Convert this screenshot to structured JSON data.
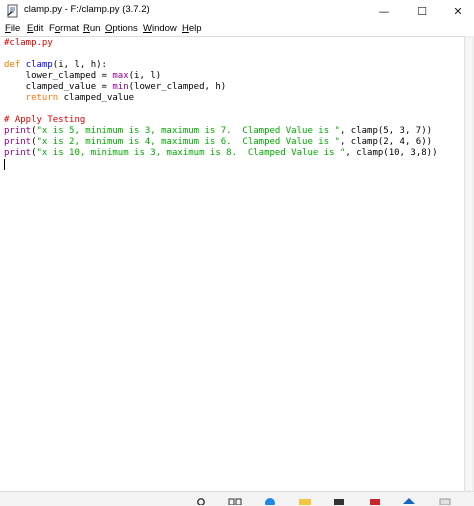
{
  "window": {
    "title": "clamp.py - F:/clamp.py (3.7.2)",
    "minimize_glyph": "—",
    "maximize_glyph": "☐",
    "close_glyph": "✕"
  },
  "menu": {
    "file": {
      "ul": "F",
      "rest": "ile"
    },
    "edit": {
      "ul": "E",
      "rest": "dit"
    },
    "format": {
      "pre": "F",
      "ul": "o",
      "rest": "rmat"
    },
    "run": {
      "ul": "R",
      "rest": "un"
    },
    "options": {
      "ul": "O",
      "rest": "ptions"
    },
    "window": {
      "ul": "W",
      "rest": "indow"
    },
    "help": {
      "ul": "H",
      "rest": "elp"
    }
  },
  "code": {
    "l1": "#clamp.py",
    "l3_kw": "def",
    "l3_fn": "clamp",
    "l3_rest": "(i, l, h):",
    "l4_pre": "    lower_clamped = ",
    "l4_bi": "max",
    "l4_rest": "(i, l)",
    "l5_pre": "    clamped_value = ",
    "l5_bi": "min",
    "l5_rest": "(lower_clamped, h)",
    "l6_kw": "    return",
    "l6_rest": " clamped_value",
    "l8": "# Apply Testing",
    "p1_bi": "print",
    "p1_open": "(",
    "p1_str": "\"x is 5, minimum is 3, maximum is 7.  Clamped Value is \"",
    "p1_rest": ", clamp(5, 3, 7))",
    "p2_bi": "print",
    "p2_open": "(",
    "p2_str": "\"x is 2, minimum is 4, maximum is 6.  Clamped Value is \"",
    "p2_rest": ", clamp(2, 4, 6))",
    "p3_bi": "print",
    "p3_open": "(",
    "p3_str": "\"x is 10, minimum is 3, maximum is 8.  Clamped Value is \"",
    "p3_rest": ", clamp(10, 3,8))"
  },
  "colors": {
    "keyword": "#ff7700",
    "comment": "#dd0000",
    "string": "#00aa00",
    "definition": "#0000ff",
    "builtin": "#900090"
  },
  "icons": [
    "idle-file-icon",
    "minimize-icon",
    "maximize-icon",
    "close-icon",
    "taskbar-app-icons"
  ]
}
